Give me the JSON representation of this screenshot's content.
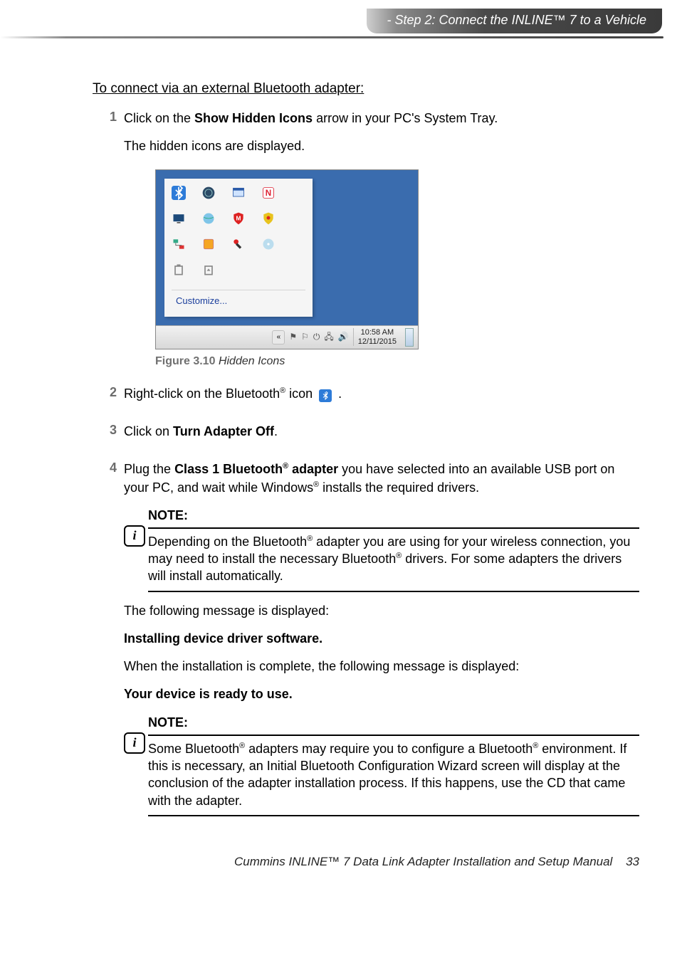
{
  "header": {
    "breadcrumb": "- Step 2: Connect the INLINE™ 7 to a Vehicle"
  },
  "section_title": "To connect via an external Bluetooth adapter:",
  "steps": {
    "s1": {
      "num": "1",
      "line1_a": "Click on the ",
      "line1_bold": "Show Hidden Icons",
      "line1_b": " arrow in your PC's System Tray.",
      "line2": "The hidden icons are displayed."
    },
    "s2": {
      "num": "2",
      "text_a": "Right-click on the Bluetooth",
      "text_b": " icon ",
      "text_c": " ."
    },
    "s3": {
      "num": "3",
      "text_a": "Click on ",
      "bold": "Turn Adapter Off",
      "text_b": "."
    },
    "s4": {
      "num": "4",
      "text_a": "Plug the ",
      "bold_a": "Class 1 Bluetooth",
      "bold_b": " adapter",
      "text_b": " you have selected into an available USB port on your PC, and wait while Windows",
      "text_c": " installs the required drivers."
    }
  },
  "figure": {
    "label": "Figure 3.10",
    "caption": "Hidden Icons",
    "customize": "Customize...",
    "clock_time": "10:58 AM",
    "clock_date": "12/11/2015",
    "icons": {
      "i0": "bluetooth",
      "i1": "globe-dark",
      "i2": "window",
      "i3": "letter-n",
      "i4": "display",
      "i5": "globe",
      "i6": "shield-m",
      "i7": "shield-y",
      "i8": "network",
      "i9": "box-o",
      "i10": "tool",
      "i11": "disc",
      "i12": "battery",
      "i13": "eject"
    }
  },
  "notes": {
    "title": "NOTE:",
    "n1_a": "Depending on the Bluetooth",
    "n1_b": " adapter you are using for your wireless connection, you may need to install the necessary Bluetooth",
    "n1_c": " drivers. For some adapters the drivers will install automatically.",
    "n2_a": "Some Bluetooth",
    "n2_b": " adapters may require you to configure a Bluetooth",
    "n2_c": " environment. If this is necessary, an Initial Bluetooth Configuration Wizard screen will display at the conclusion of the adapter installation process. If this happens, use the CD that came with the adapter."
  },
  "after_note": {
    "l1": "The following message is displayed:",
    "l2": "Installing device driver software.",
    "l3": "When the installation is complete, the following message is displayed:",
    "l4": "Your device is ready to use."
  },
  "footer": {
    "text": "Cummins INLINE™ 7 Data Link Adapter Installation and Setup Manual",
    "page": "33"
  },
  "glyphs": {
    "reg": "®"
  }
}
